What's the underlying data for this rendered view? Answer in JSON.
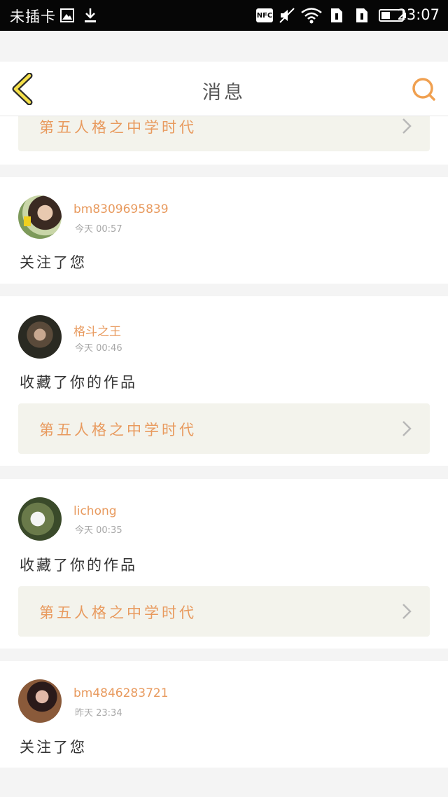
{
  "status_bar": {
    "carrier": "未插卡",
    "nfc_label": "NFC",
    "time": "23:07",
    "icons": [
      "image-icon",
      "download-icon",
      "nfc-icon",
      "mute-icon",
      "wifi-icon",
      "sim1-icon",
      "sim2-icon",
      "battery-icon"
    ]
  },
  "header": {
    "title": "消息",
    "back_icon": "chevron-left-icon",
    "search_icon": "search-icon"
  },
  "colors": {
    "accent": "#e89a5e",
    "back_arrow_fill": "#f5e04a",
    "link_bg": "#f3f3ec"
  },
  "notifications": [
    {
      "partial": true,
      "work_title": "第五人格之中学时代"
    },
    {
      "username": "bm8309695839",
      "time": "今天 00:57",
      "action": "关注了您"
    },
    {
      "username": "格斗之王",
      "time": "今天 00:46",
      "action": "收藏了你的作品",
      "work_title": "第五人格之中学时代"
    },
    {
      "username": "lichong",
      "time": "今天 00:35",
      "action": "收藏了你的作品",
      "work_title": "第五人格之中学时代"
    },
    {
      "username": "bm4846283721",
      "time": "昨天 23:34",
      "action": "关注了您"
    }
  ]
}
